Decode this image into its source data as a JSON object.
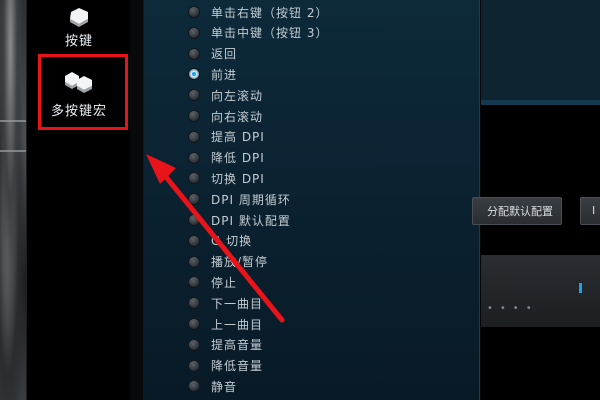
{
  "sidebar": {
    "items": [
      {
        "label": "按键",
        "icon": "key-icon"
      },
      {
        "label": "多按键宏",
        "icon": "multi-key-macro-icon"
      }
    ]
  },
  "options": [
    {
      "label": "单击右键（按钮 2）",
      "selected": false
    },
    {
      "label": "单击中键（按钮 3）",
      "selected": false
    },
    {
      "label": "返回",
      "selected": false
    },
    {
      "label": "前进",
      "selected": true
    },
    {
      "label": "向左滚动",
      "selected": false
    },
    {
      "label": "向右滚动",
      "selected": false
    },
    {
      "label": "提高 DPI",
      "selected": false
    },
    {
      "label": "降低 DPI",
      "selected": false
    },
    {
      "label": "切换 DPI",
      "selected": false
    },
    {
      "label": "DPI 周期循环",
      "selected": false
    },
    {
      "label": "DPI 默认配置",
      "selected": false
    },
    {
      "label": "G 切换",
      "selected": false
    },
    {
      "label": "播放/暂停",
      "selected": false
    },
    {
      "label": "停止",
      "selected": false
    },
    {
      "label": "下一曲目",
      "selected": false
    },
    {
      "label": "上一曲目",
      "selected": false
    },
    {
      "label": "提高音量",
      "selected": false
    },
    {
      "label": "降低音量",
      "selected": false
    },
    {
      "label": "静音",
      "selected": false
    }
  ],
  "right": {
    "assign_default_label": "分配默认配置",
    "edge_button_label": "I"
  },
  "colors": {
    "highlight": "#e8141a",
    "accent": "#1aa3e8",
    "panel": "#0b2231"
  }
}
